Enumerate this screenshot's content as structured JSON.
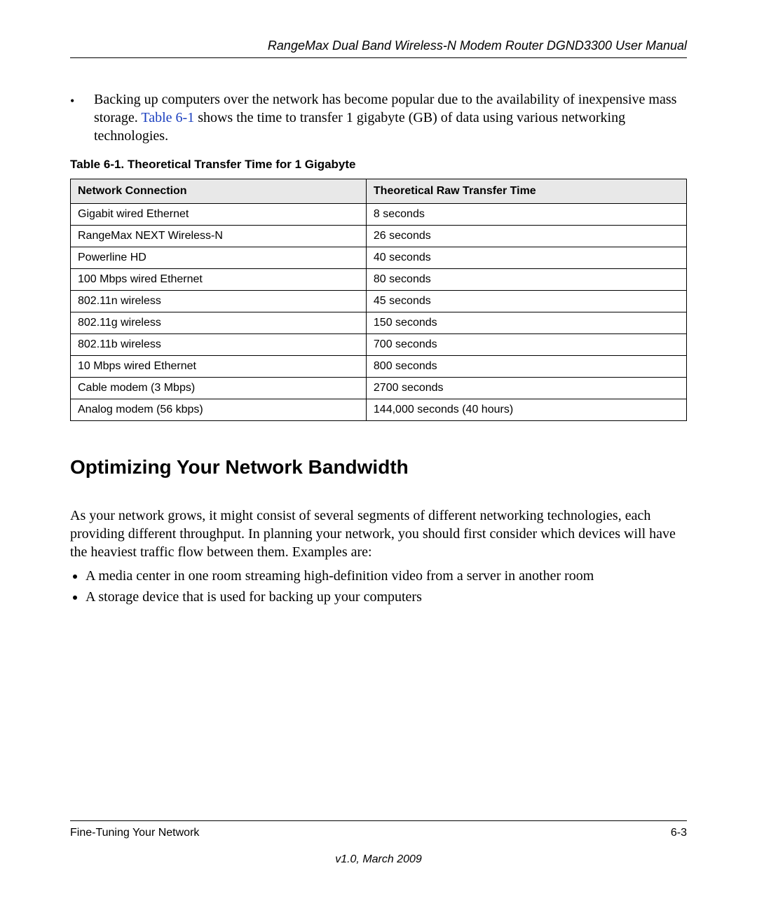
{
  "header": {
    "title": "RangeMax Dual Band Wireless-N Modem Router DGND3300 User Manual"
  },
  "intro_bullet": {
    "pre_link": "Backing up computers over the network has become popular due to the availability of inexpensive mass storage. ",
    "link_text": "Table 6-1",
    "post_link": " shows the time to transfer 1 gigabyte (GB) of data using various networking technologies."
  },
  "table": {
    "caption": "Table 6-1.  Theoretical Transfer Time for 1 Gigabyte",
    "columns": [
      "Network Connection",
      "Theoretical Raw Transfer Time"
    ],
    "rows": [
      [
        "Gigabit wired Ethernet",
        "8 seconds"
      ],
      [
        "RangeMax NEXT Wireless-N",
        "26 seconds"
      ],
      [
        "Powerline HD",
        "40 seconds"
      ],
      [
        "100 Mbps wired Ethernet",
        "80 seconds"
      ],
      [
        "802.11n wireless",
        "45 seconds"
      ],
      [
        "802.11g wireless",
        "150 seconds"
      ],
      [
        "802.11b wireless",
        "700 seconds"
      ],
      [
        "10 Mbps wired Ethernet",
        "800 seconds"
      ],
      [
        "Cable modem (3 Mbps)",
        "2700 seconds"
      ],
      [
        "Analog modem (56 kbps)",
        "144,000 seconds (40 hours)"
      ]
    ]
  },
  "section": {
    "heading": "Optimizing Your Network Bandwidth",
    "para": "As your network grows, it might consist of several segments of different networking technologies, each providing different throughput. In planning your network, you should first consider which devices will have the heaviest traffic flow between them. Examples are:",
    "items": [
      "A media center in one room streaming high-definition video from a server in another room",
      "A storage device that is used for backing up your computers"
    ]
  },
  "footer": {
    "left": "Fine-Tuning Your Network",
    "right": "6-3",
    "version": "v1.0, March 2009"
  },
  "chart_data": {
    "type": "table",
    "title": "Table 6-1. Theoretical Transfer Time for 1 Gigabyte",
    "columns": [
      "Network Connection",
      "Theoretical Raw Transfer Time"
    ],
    "rows": [
      {
        "connection": "Gigabit wired Ethernet",
        "time": "8 seconds"
      },
      {
        "connection": "RangeMax NEXT Wireless-N",
        "time": "26 seconds"
      },
      {
        "connection": "Powerline HD",
        "time": "40 seconds"
      },
      {
        "connection": "100 Mbps wired Ethernet",
        "time": "80 seconds"
      },
      {
        "connection": "802.11n wireless",
        "time": "45 seconds"
      },
      {
        "connection": "802.11g wireless",
        "time": "150 seconds"
      },
      {
        "connection": "802.11b wireless",
        "time": "700 seconds"
      },
      {
        "connection": "10 Mbps wired Ethernet",
        "time": "800 seconds"
      },
      {
        "connection": "Cable modem (3 Mbps)",
        "time": "2700 seconds"
      },
      {
        "connection": "Analog modem (56 kbps)",
        "time": "144,000 seconds (40 hours)"
      }
    ]
  }
}
